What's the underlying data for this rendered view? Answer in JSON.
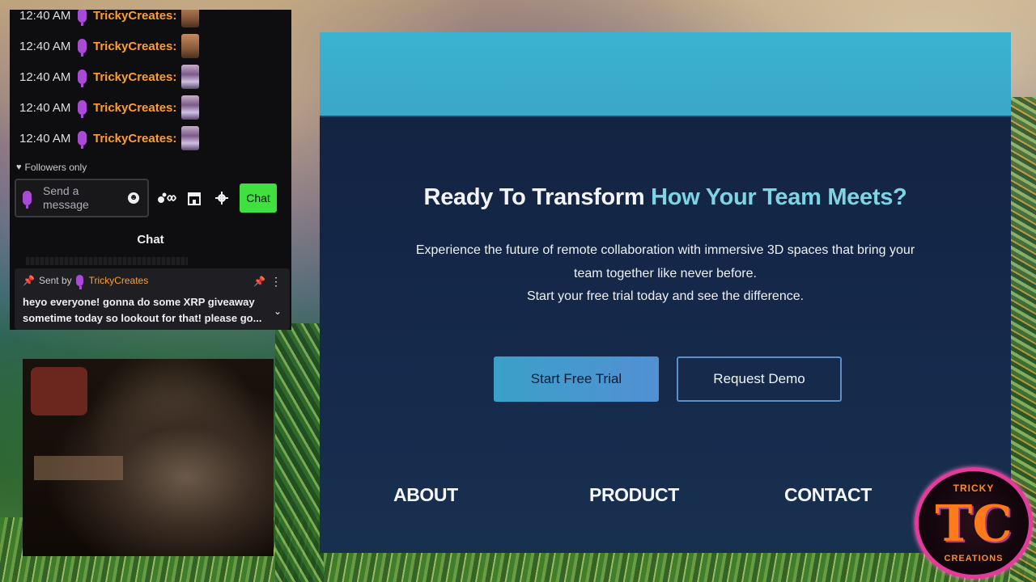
{
  "chat": {
    "messages": [
      {
        "time": "12:40 AM",
        "user": "TrickyCreates",
        "emote": "face-emote"
      },
      {
        "time": "12:40 AM",
        "user": "TrickyCreates",
        "emote": "face-emote"
      },
      {
        "time": "12:40 AM",
        "user": "TrickyCreates",
        "emote": "flag-emote"
      },
      {
        "time": "12:40 AM",
        "user": "TrickyCreates",
        "emote": "flag-emote"
      },
      {
        "time": "12:40 AM",
        "user": "TrickyCreates",
        "emote": "flag-emote"
      }
    ],
    "followers_only": "Followers only",
    "input_placeholder": "Send a message",
    "send_label": "Chat",
    "header": "Chat",
    "pinned": {
      "sent_by_label": "Sent by",
      "user": "TrickyCreates",
      "text": "heyo everyone! gonna do some XRP giveaway sometime today so lookout for that! please go..."
    }
  },
  "site": {
    "title_part1": "Ready To Transform ",
    "title_accent": "How Your Team Meets?",
    "subtitle_line1": "Experience the future of remote collaboration with immersive 3D spaces that bring your",
    "subtitle_line2": "team together like never before.",
    "subtitle_line3": "Start your free trial today and see the difference.",
    "primary_button": "Start Free Trial",
    "secondary_button": "Request Demo",
    "footer_links": [
      "ABOUT",
      "PRODUCT",
      "CONTACT"
    ]
  },
  "logo": {
    "top_text": "TRICKY",
    "mark": "TC",
    "bottom_text": "CREATIONS"
  },
  "colors": {
    "chat_bg": "#0e0e10",
    "username": "#ff9d2e",
    "send_button": "#3fe03f",
    "accent_title": "#7fd3e6",
    "site_bar": "#3ab3d0",
    "site_bg": "#13213f"
  }
}
